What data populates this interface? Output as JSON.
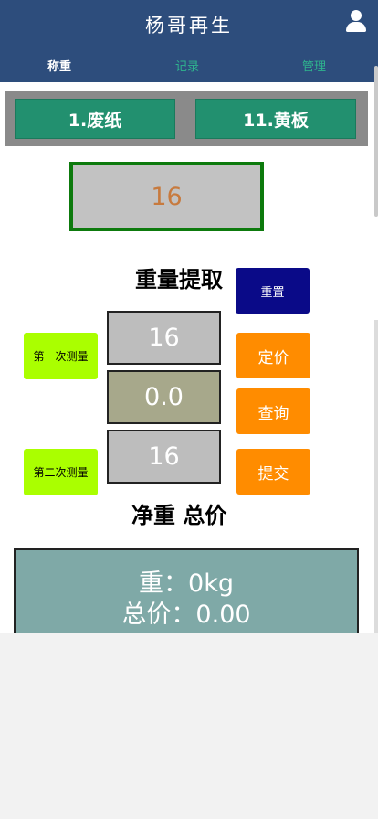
{
  "header": {
    "title": "杨哥再生",
    "user_icon": "user-icon"
  },
  "tabs": [
    {
      "label": "称重",
      "active": true
    },
    {
      "label": "记录",
      "active": false
    },
    {
      "label": "管理",
      "active": false
    }
  ],
  "categories": [
    {
      "label": "1.废纸"
    },
    {
      "label": "11.黄板"
    }
  ],
  "display": {
    "value": "16"
  },
  "weight_section": {
    "heading": "重量提取"
  },
  "reset_button": {
    "label": "重置"
  },
  "first_measure_button": {
    "label": "第一次测量"
  },
  "second_measure_button": {
    "label": "第二次测量"
  },
  "values": {
    "first": "16",
    "middle": "0.0",
    "second": "16"
  },
  "actions": {
    "price": "定价",
    "query": "查询",
    "submit": "提交"
  },
  "net_section": {
    "heading": "净重 总价"
  },
  "result": {
    "weight_line": "重：0kg",
    "total_line": "总价：0.00"
  },
  "colors": {
    "header_bg": "#2d4d7c",
    "category_button": "#22906f",
    "display_border": "#0d7a0d",
    "display_text": "#c77a3e",
    "reset_button": "#0a0a88",
    "measure_button": "#aaff00",
    "action_button": "#ff8c00",
    "result_bg": "#7fa9a7",
    "inactive_tab": "#2fb58e"
  }
}
